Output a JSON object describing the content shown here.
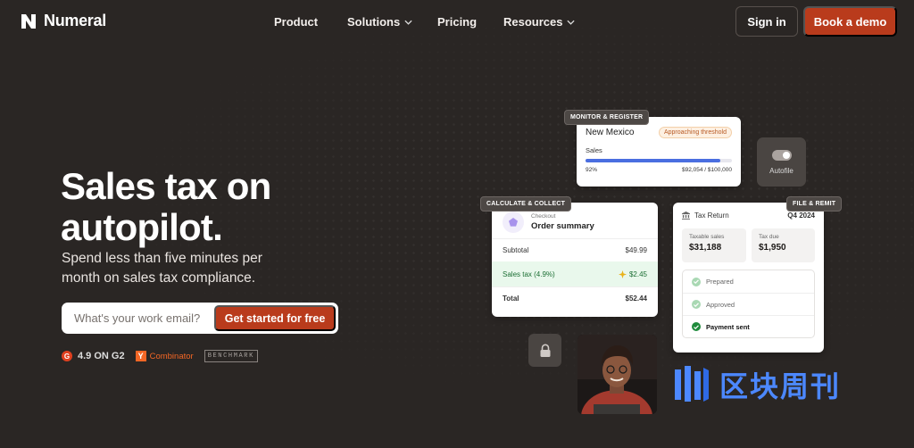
{
  "header": {
    "brand": "Numeral",
    "nav": [
      {
        "label": "Product",
        "has_dropdown": false
      },
      {
        "label": "Solutions",
        "has_dropdown": true
      },
      {
        "label": "Pricing",
        "has_dropdown": false
      },
      {
        "label": "Resources",
        "has_dropdown": true
      }
    ],
    "signin_label": "Sign in",
    "demo_label": "Book a demo"
  },
  "hero": {
    "title": "Sales tax on autopilot.",
    "subtitle": "Spend less than five minutes per month on sales tax compliance.",
    "email_placeholder": "What's your work email?",
    "cta_label": "Get started for free",
    "badges": {
      "g2": "4.9 ON G2",
      "g2_mark": "G",
      "yc": "Combinator",
      "yc_mark": "Y",
      "benchmark": "BENCHMARK"
    }
  },
  "monitor": {
    "tag": "MONITOR & REGISTER",
    "state": "New Mexico",
    "badge": "Approaching threshold",
    "sales_label": "Sales",
    "progress": 0.92,
    "percent_text": "92%",
    "amount_text": "$92,054 / $100,000"
  },
  "autofile": {
    "label": "Autofile",
    "enabled": true
  },
  "calculate": {
    "tag": "CALCULATE & COLLECT",
    "checkout_label": "Checkout",
    "title": "Order summary",
    "rows": [
      {
        "label": "Subtotal",
        "value": "$49.99"
      },
      {
        "label": "Sales tax (4.9%)",
        "value": "$2.45"
      },
      {
        "label": "Total",
        "value": "$52.44"
      }
    ]
  },
  "file": {
    "tag": "FILE & REMIT",
    "title": "Tax Return",
    "period": "Q4 2024",
    "taxable_label": "Taxable sales",
    "taxable_value": "$31,188",
    "taxdue_label": "Tax due",
    "taxdue_value": "$1,950",
    "statuses": [
      "Prepared",
      "Approved",
      "Payment sent"
    ]
  },
  "watermark": {
    "text": "区块周刊"
  },
  "colors": {
    "background": "#2a2624",
    "accent": "#b93b1c",
    "progress": "#4a6ee0",
    "success": "#1f8b3c",
    "watermark": "#4c88ff"
  },
  "icons": [
    "numeral-logo-icon",
    "chevron-down-icon",
    "pentagon-icon",
    "bank-icon",
    "check-icon",
    "lock-icon",
    "sparkle-icon",
    "toggle-icon"
  ]
}
